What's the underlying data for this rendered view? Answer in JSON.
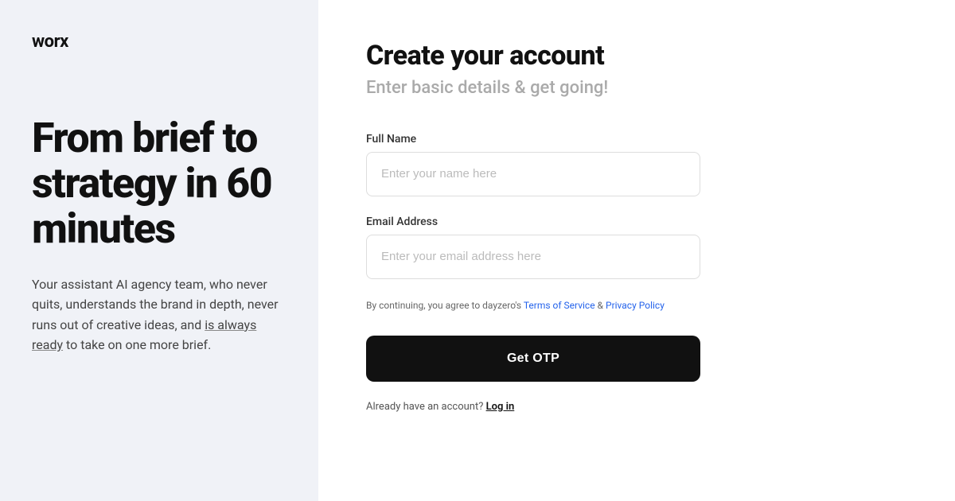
{
  "left": {
    "logo": "worx",
    "headline": "From brief to strategy in 60 minutes",
    "subtext": "Your assistant AI agency team, who never quits, understands the brand in depth, never runs out of creative ideas, and is always ready to take on one more brief."
  },
  "right": {
    "title": "Create your account",
    "subtitle": "Enter basic details & get going!",
    "full_name_label": "Full Name",
    "full_name_placeholder": "Enter your name here",
    "email_label": "Email Address",
    "email_placeholder": "Enter your email address here",
    "terms_prefix": "By continuing, you agree to dayzero's ",
    "terms_link1": "Terms of Service",
    "terms_between": " & ",
    "terms_link2": "Privacy Policy",
    "otp_button": "Get OTP",
    "login_prefix": "Already have an account? ",
    "login_link": "Log in"
  }
}
